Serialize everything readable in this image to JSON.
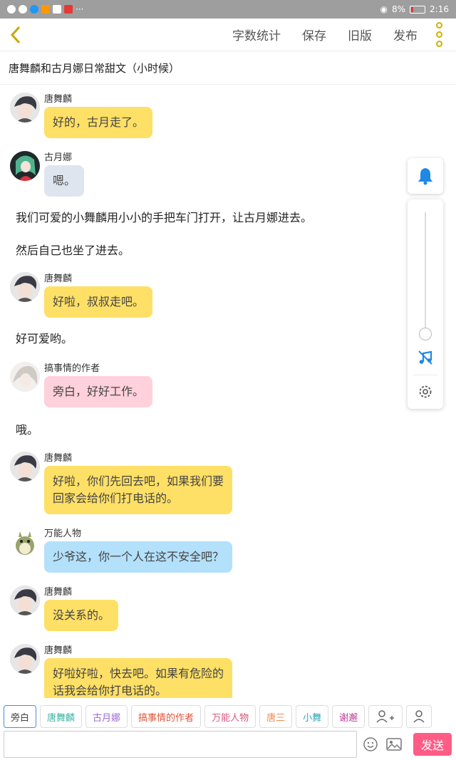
{
  "status_bar": {
    "battery": "8%",
    "time": "2:16"
  },
  "toolbar": {
    "word_count": "字数统计",
    "save": "保存",
    "old_version": "旧版",
    "publish": "发布"
  },
  "story_title": "唐舞麟和古月娜日常甜文（小时候）",
  "messages": [
    {
      "sender": "唐舞麟",
      "text": "好的，古月走了。",
      "color": "#ffe066"
    },
    {
      "sender": "古月娜",
      "text": "嗯。",
      "color": "#dfe5ee"
    },
    {
      "narration": "我们可爱的小舞麟用小小的手把车门打开，让古月娜进去。"
    },
    {
      "narration": "然后自己也坐了进去。"
    },
    {
      "sender": "唐舞麟",
      "text": "好啦，叔叔走吧。",
      "color": "#ffe066"
    },
    {
      "narration": "好可爱哟。"
    },
    {
      "sender": "搞事情的作者",
      "text": "旁白，好好工作。",
      "color": "#ffd1dc"
    },
    {
      "narration": "哦。"
    },
    {
      "sender": "唐舞麟",
      "text_lines": [
        "好啦，你们先回去吧，如果我们要",
        "回家会给你们打电话的。"
      ],
      "color": "#ffe066"
    },
    {
      "sender": "万能人物",
      "text": "少爷这，你一个人在这不安全吧？",
      "color": "#b3e0fb"
    },
    {
      "sender": "唐舞麟",
      "text": "没关系的。",
      "color": "#ffe066"
    },
    {
      "sender": "唐舞麟",
      "text_lines": [
        "好啦好啦，快去吧。如果有危险的",
        "话我会给你打电话的。"
      ],
      "color": "#ffe066"
    }
  ],
  "roles": [
    {
      "label": "旁白",
      "color": "#444444"
    },
    {
      "label": "唐舞麟",
      "color": "#3fb3a6"
    },
    {
      "label": "古月娜",
      "color": "#9c6ad6"
    },
    {
      "label": "搞事情的作者",
      "color": "#e0553a"
    },
    {
      "label": "万能人物",
      "color": "#d8577a"
    },
    {
      "label": "唐三",
      "color": "#f08a4b"
    },
    {
      "label": "小舞",
      "color": "#2fa9b8"
    },
    {
      "label": "谢邂",
      "color": "#c0399a"
    }
  ],
  "input": {
    "value": "",
    "placeholder": ""
  },
  "send_label": "发送",
  "icons": [
    "back-icon",
    "more-icon",
    "bell-icon",
    "music-off-icon",
    "gear-icon",
    "add-role-icon",
    "person-icon",
    "emoji-icon",
    "image-icon"
  ],
  "accent_color": "#c8a800"
}
